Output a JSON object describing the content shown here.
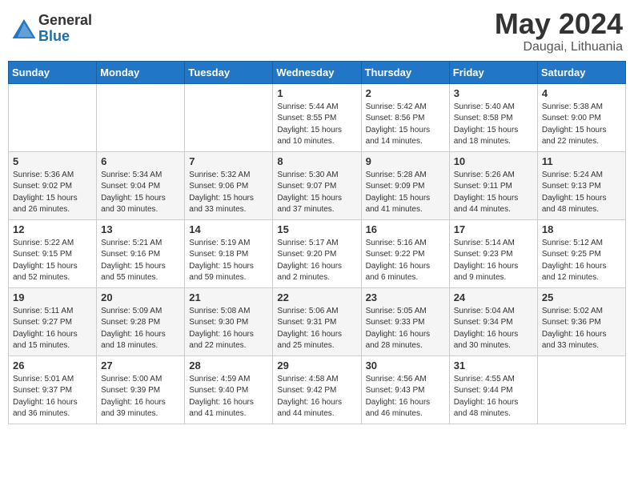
{
  "header": {
    "logo_general": "General",
    "logo_blue": "Blue",
    "month_year": "May 2024",
    "location": "Daugai, Lithuania"
  },
  "calendar": {
    "days_of_week": [
      "Sunday",
      "Monday",
      "Tuesday",
      "Wednesday",
      "Thursday",
      "Friday",
      "Saturday"
    ],
    "weeks": [
      [
        {
          "day": "",
          "content": ""
        },
        {
          "day": "",
          "content": ""
        },
        {
          "day": "",
          "content": ""
        },
        {
          "day": "1",
          "content": "Sunrise: 5:44 AM\nSunset: 8:55 PM\nDaylight: 15 hours\nand 10 minutes."
        },
        {
          "day": "2",
          "content": "Sunrise: 5:42 AM\nSunset: 8:56 PM\nDaylight: 15 hours\nand 14 minutes."
        },
        {
          "day": "3",
          "content": "Sunrise: 5:40 AM\nSunset: 8:58 PM\nDaylight: 15 hours\nand 18 minutes."
        },
        {
          "day": "4",
          "content": "Sunrise: 5:38 AM\nSunset: 9:00 PM\nDaylight: 15 hours\nand 22 minutes."
        }
      ],
      [
        {
          "day": "5",
          "content": "Sunrise: 5:36 AM\nSunset: 9:02 PM\nDaylight: 15 hours\nand 26 minutes."
        },
        {
          "day": "6",
          "content": "Sunrise: 5:34 AM\nSunset: 9:04 PM\nDaylight: 15 hours\nand 30 minutes."
        },
        {
          "day": "7",
          "content": "Sunrise: 5:32 AM\nSunset: 9:06 PM\nDaylight: 15 hours\nand 33 minutes."
        },
        {
          "day": "8",
          "content": "Sunrise: 5:30 AM\nSunset: 9:07 PM\nDaylight: 15 hours\nand 37 minutes."
        },
        {
          "day": "9",
          "content": "Sunrise: 5:28 AM\nSunset: 9:09 PM\nDaylight: 15 hours\nand 41 minutes."
        },
        {
          "day": "10",
          "content": "Sunrise: 5:26 AM\nSunset: 9:11 PM\nDaylight: 15 hours\nand 44 minutes."
        },
        {
          "day": "11",
          "content": "Sunrise: 5:24 AM\nSunset: 9:13 PM\nDaylight: 15 hours\nand 48 minutes."
        }
      ],
      [
        {
          "day": "12",
          "content": "Sunrise: 5:22 AM\nSunset: 9:15 PM\nDaylight: 15 hours\nand 52 minutes."
        },
        {
          "day": "13",
          "content": "Sunrise: 5:21 AM\nSunset: 9:16 PM\nDaylight: 15 hours\nand 55 minutes."
        },
        {
          "day": "14",
          "content": "Sunrise: 5:19 AM\nSunset: 9:18 PM\nDaylight: 15 hours\nand 59 minutes."
        },
        {
          "day": "15",
          "content": "Sunrise: 5:17 AM\nSunset: 9:20 PM\nDaylight: 16 hours\nand 2 minutes."
        },
        {
          "day": "16",
          "content": "Sunrise: 5:16 AM\nSunset: 9:22 PM\nDaylight: 16 hours\nand 6 minutes."
        },
        {
          "day": "17",
          "content": "Sunrise: 5:14 AM\nSunset: 9:23 PM\nDaylight: 16 hours\nand 9 minutes."
        },
        {
          "day": "18",
          "content": "Sunrise: 5:12 AM\nSunset: 9:25 PM\nDaylight: 16 hours\nand 12 minutes."
        }
      ],
      [
        {
          "day": "19",
          "content": "Sunrise: 5:11 AM\nSunset: 9:27 PM\nDaylight: 16 hours\nand 15 minutes."
        },
        {
          "day": "20",
          "content": "Sunrise: 5:09 AM\nSunset: 9:28 PM\nDaylight: 16 hours\nand 18 minutes."
        },
        {
          "day": "21",
          "content": "Sunrise: 5:08 AM\nSunset: 9:30 PM\nDaylight: 16 hours\nand 22 minutes."
        },
        {
          "day": "22",
          "content": "Sunrise: 5:06 AM\nSunset: 9:31 PM\nDaylight: 16 hours\nand 25 minutes."
        },
        {
          "day": "23",
          "content": "Sunrise: 5:05 AM\nSunset: 9:33 PM\nDaylight: 16 hours\nand 28 minutes."
        },
        {
          "day": "24",
          "content": "Sunrise: 5:04 AM\nSunset: 9:34 PM\nDaylight: 16 hours\nand 30 minutes."
        },
        {
          "day": "25",
          "content": "Sunrise: 5:02 AM\nSunset: 9:36 PM\nDaylight: 16 hours\nand 33 minutes."
        }
      ],
      [
        {
          "day": "26",
          "content": "Sunrise: 5:01 AM\nSunset: 9:37 PM\nDaylight: 16 hours\nand 36 minutes."
        },
        {
          "day": "27",
          "content": "Sunrise: 5:00 AM\nSunset: 9:39 PM\nDaylight: 16 hours\nand 39 minutes."
        },
        {
          "day": "28",
          "content": "Sunrise: 4:59 AM\nSunset: 9:40 PM\nDaylight: 16 hours\nand 41 minutes."
        },
        {
          "day": "29",
          "content": "Sunrise: 4:58 AM\nSunset: 9:42 PM\nDaylight: 16 hours\nand 44 minutes."
        },
        {
          "day": "30",
          "content": "Sunrise: 4:56 AM\nSunset: 9:43 PM\nDaylight: 16 hours\nand 46 minutes."
        },
        {
          "day": "31",
          "content": "Sunrise: 4:55 AM\nSunset: 9:44 PM\nDaylight: 16 hours\nand 48 minutes."
        },
        {
          "day": "",
          "content": ""
        }
      ]
    ]
  }
}
